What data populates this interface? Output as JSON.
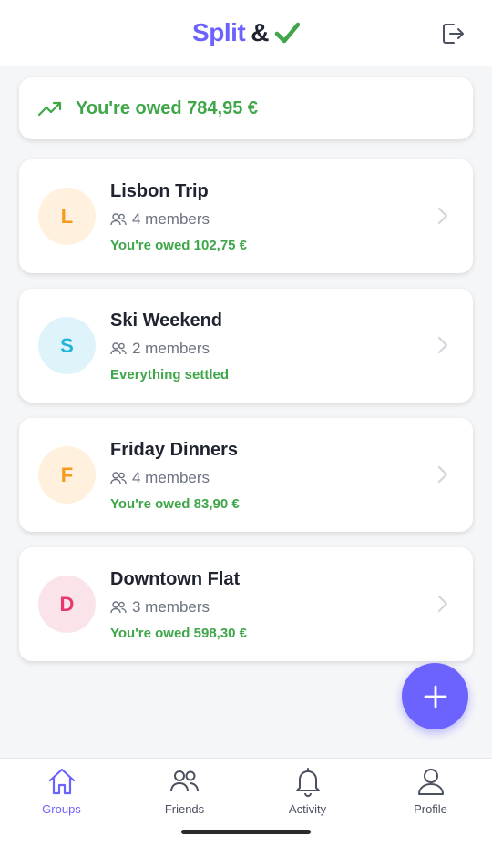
{
  "app": {
    "logo_word": "Split",
    "logo_amp": "&",
    "brand_color": "#6c63ff",
    "positive_color": "#3fa64a"
  },
  "header": {
    "logout_icon": "logout-icon"
  },
  "summary": {
    "icon": "trending-up-icon",
    "text": "You're owed 784,95 €"
  },
  "groups": [
    {
      "initial": "L",
      "name": "Lisbon Trip",
      "members": "4 members",
      "balance": "You're owed 102,75 €",
      "avatar_bg": "#fff1dd",
      "avatar_fg": "#f59a1b"
    },
    {
      "initial": "S",
      "name": "Ski Weekend",
      "members": "2 members",
      "balance": "Everything settled",
      "avatar_bg": "#dff4fa",
      "avatar_fg": "#1fb6d9"
    },
    {
      "initial": "F",
      "name": "Friday Dinners",
      "members": "4 members",
      "balance": "You're owed 83,90 €",
      "avatar_bg": "#fff1dd",
      "avatar_fg": "#f59a1b"
    },
    {
      "initial": "D",
      "name": "Downtown Flat",
      "members": "3 members",
      "balance": "You're owed 598,30 €",
      "avatar_bg": "#fbe3ea",
      "avatar_fg": "#e63a6b"
    }
  ],
  "fab": {
    "icon": "plus-icon"
  },
  "nav": [
    {
      "label": "Groups",
      "icon": "home-icon",
      "active": true
    },
    {
      "label": "Friends",
      "icon": "users-icon",
      "active": false
    },
    {
      "label": "Activity",
      "icon": "bell-icon",
      "active": false
    },
    {
      "label": "Profile",
      "icon": "user-icon",
      "active": false
    }
  ]
}
